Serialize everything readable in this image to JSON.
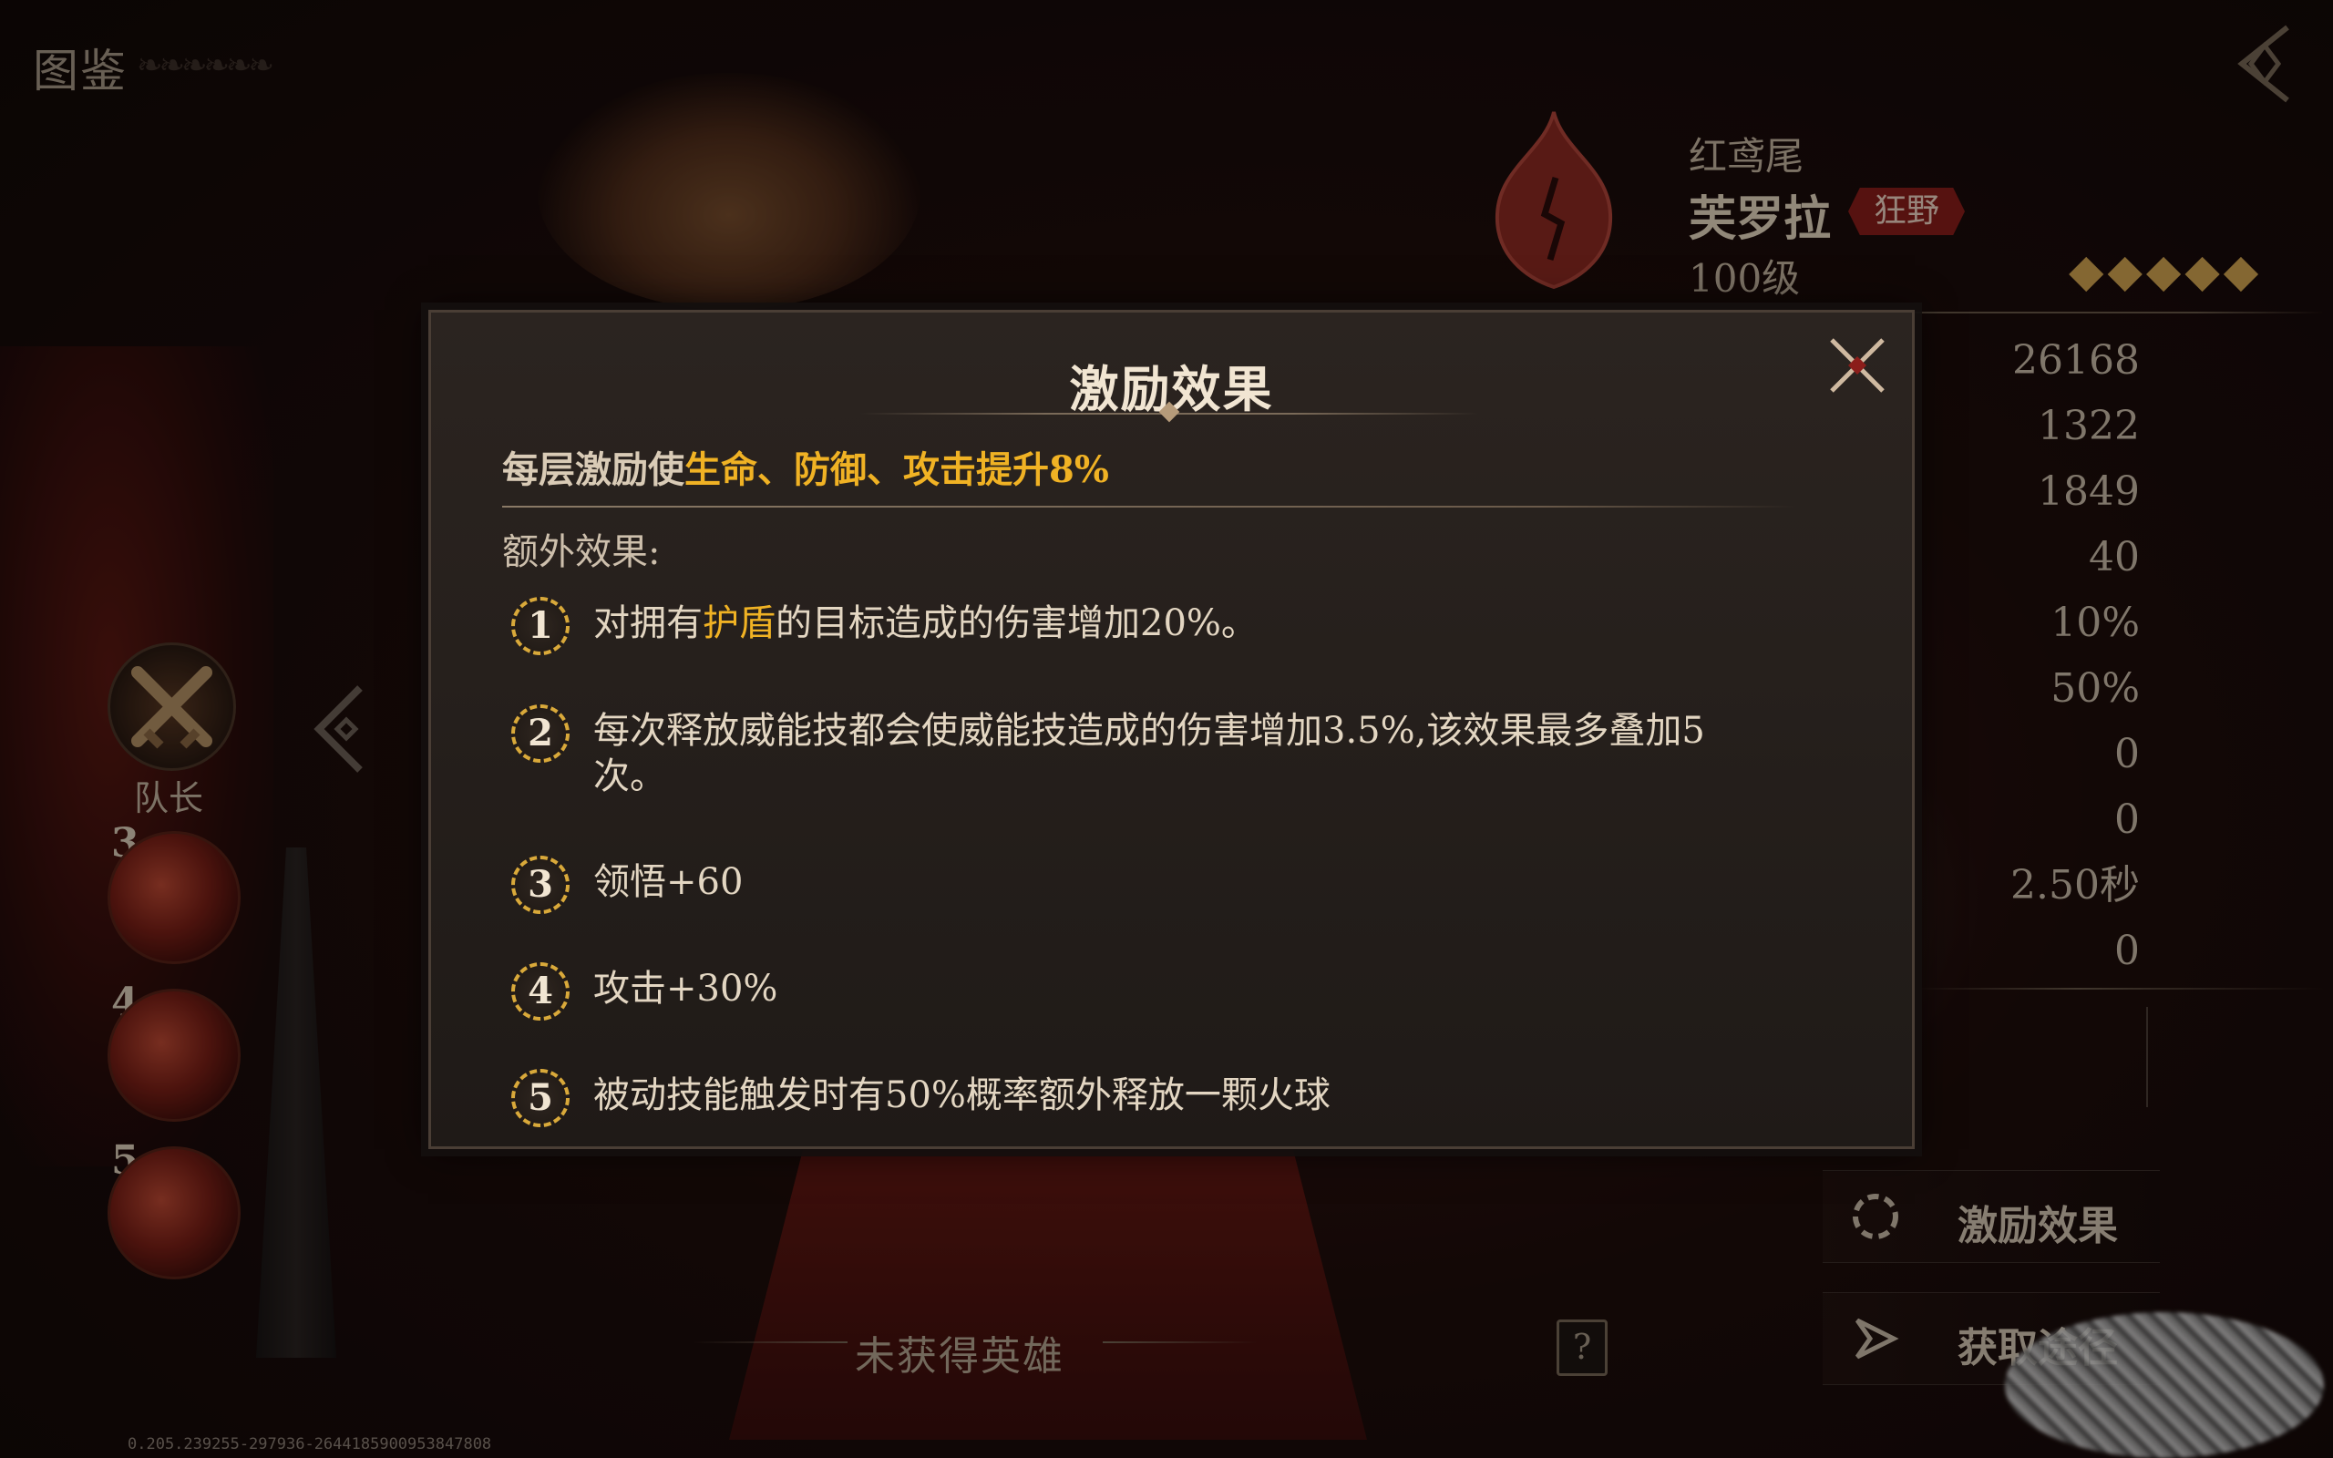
{
  "header": {
    "title": "图鉴"
  },
  "hero": {
    "title": "红鸢尾",
    "name": "芙罗拉",
    "faction": "狂野",
    "level": "100级",
    "stars": "◆◆◆◆◆",
    "star_count": 5,
    "stats": [
      "26168",
      "1322",
      "1849",
      "40",
      "10%",
      "50%",
      "0",
      "0",
      "2.50秒",
      "0"
    ]
  },
  "team": {
    "captain_label": "队长",
    "members": [
      "3",
      "4",
      "5"
    ]
  },
  "right_buttons": {
    "inspire": "激励效果",
    "obtain": "获取途径"
  },
  "bottom": {
    "unowned": "未获得英雄",
    "help": "?",
    "debug": "0.205.239255-297936-2644185900953847808"
  },
  "modal": {
    "title": "激励效果",
    "summary_prefix": "每层激励使",
    "summary_highlight": "生命、防御、攻击提升8%",
    "extra_label": "额外效果:",
    "effects": [
      {
        "num": "1",
        "pre": "对拥有",
        "hl": "护盾",
        "post": "的目标造成的伤害增加20%。"
      },
      {
        "num": "2",
        "text": "每次释放威能技都会使威能技造成的伤害增加3.5%,该效果最多叠加5次。"
      },
      {
        "num": "3",
        "text": "领悟+60"
      },
      {
        "num": "4",
        "text": "攻击+30%"
      },
      {
        "num": "5",
        "text": "被动技能触发时有50%概率额外释放一颗火球"
      }
    ]
  },
  "colors": {
    "highlight": "#f0b224",
    "badge": "#8b1d1a",
    "star": "#d6a752"
  }
}
